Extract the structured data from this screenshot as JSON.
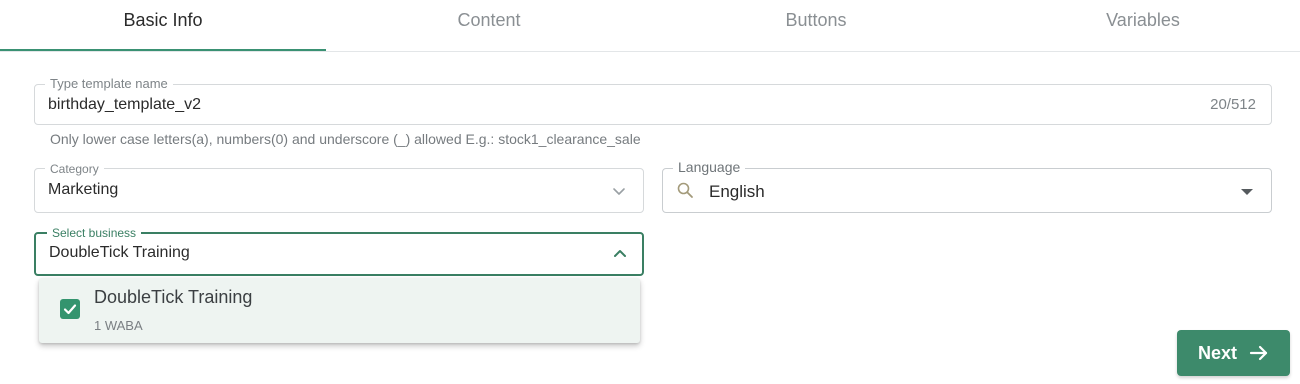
{
  "tabs": [
    {
      "label": "Basic Info",
      "active": true
    },
    {
      "label": "Content",
      "active": false
    },
    {
      "label": "Buttons",
      "active": false
    },
    {
      "label": "Variables",
      "active": false
    }
  ],
  "template_name": {
    "legend": "Type template name",
    "value": "birthday_template_v2",
    "counter": "20/512",
    "helper": "Only lower case letters(a), numbers(0) and underscore (_) allowed E.g.: stock1_clearance_sale"
  },
  "category": {
    "legend": "Category",
    "value": "Marketing",
    "icon": "chevron-down-icon"
  },
  "language": {
    "legend": "Language",
    "value": "English",
    "icon": "search-icon"
  },
  "business": {
    "legend": "Select business",
    "value": "DoubleTick Training",
    "icon": "chevron-up-icon",
    "options": [
      {
        "label": "DoubleTick Training",
        "sub": "1 WABA",
        "checked": true
      }
    ]
  },
  "actions": {
    "next_label": "Next",
    "next_icon": "arrow-right-icon"
  },
  "colors": {
    "accent": "#3a9173",
    "button": "#3d8a6b",
    "selected_bg": "#eef4f1"
  }
}
